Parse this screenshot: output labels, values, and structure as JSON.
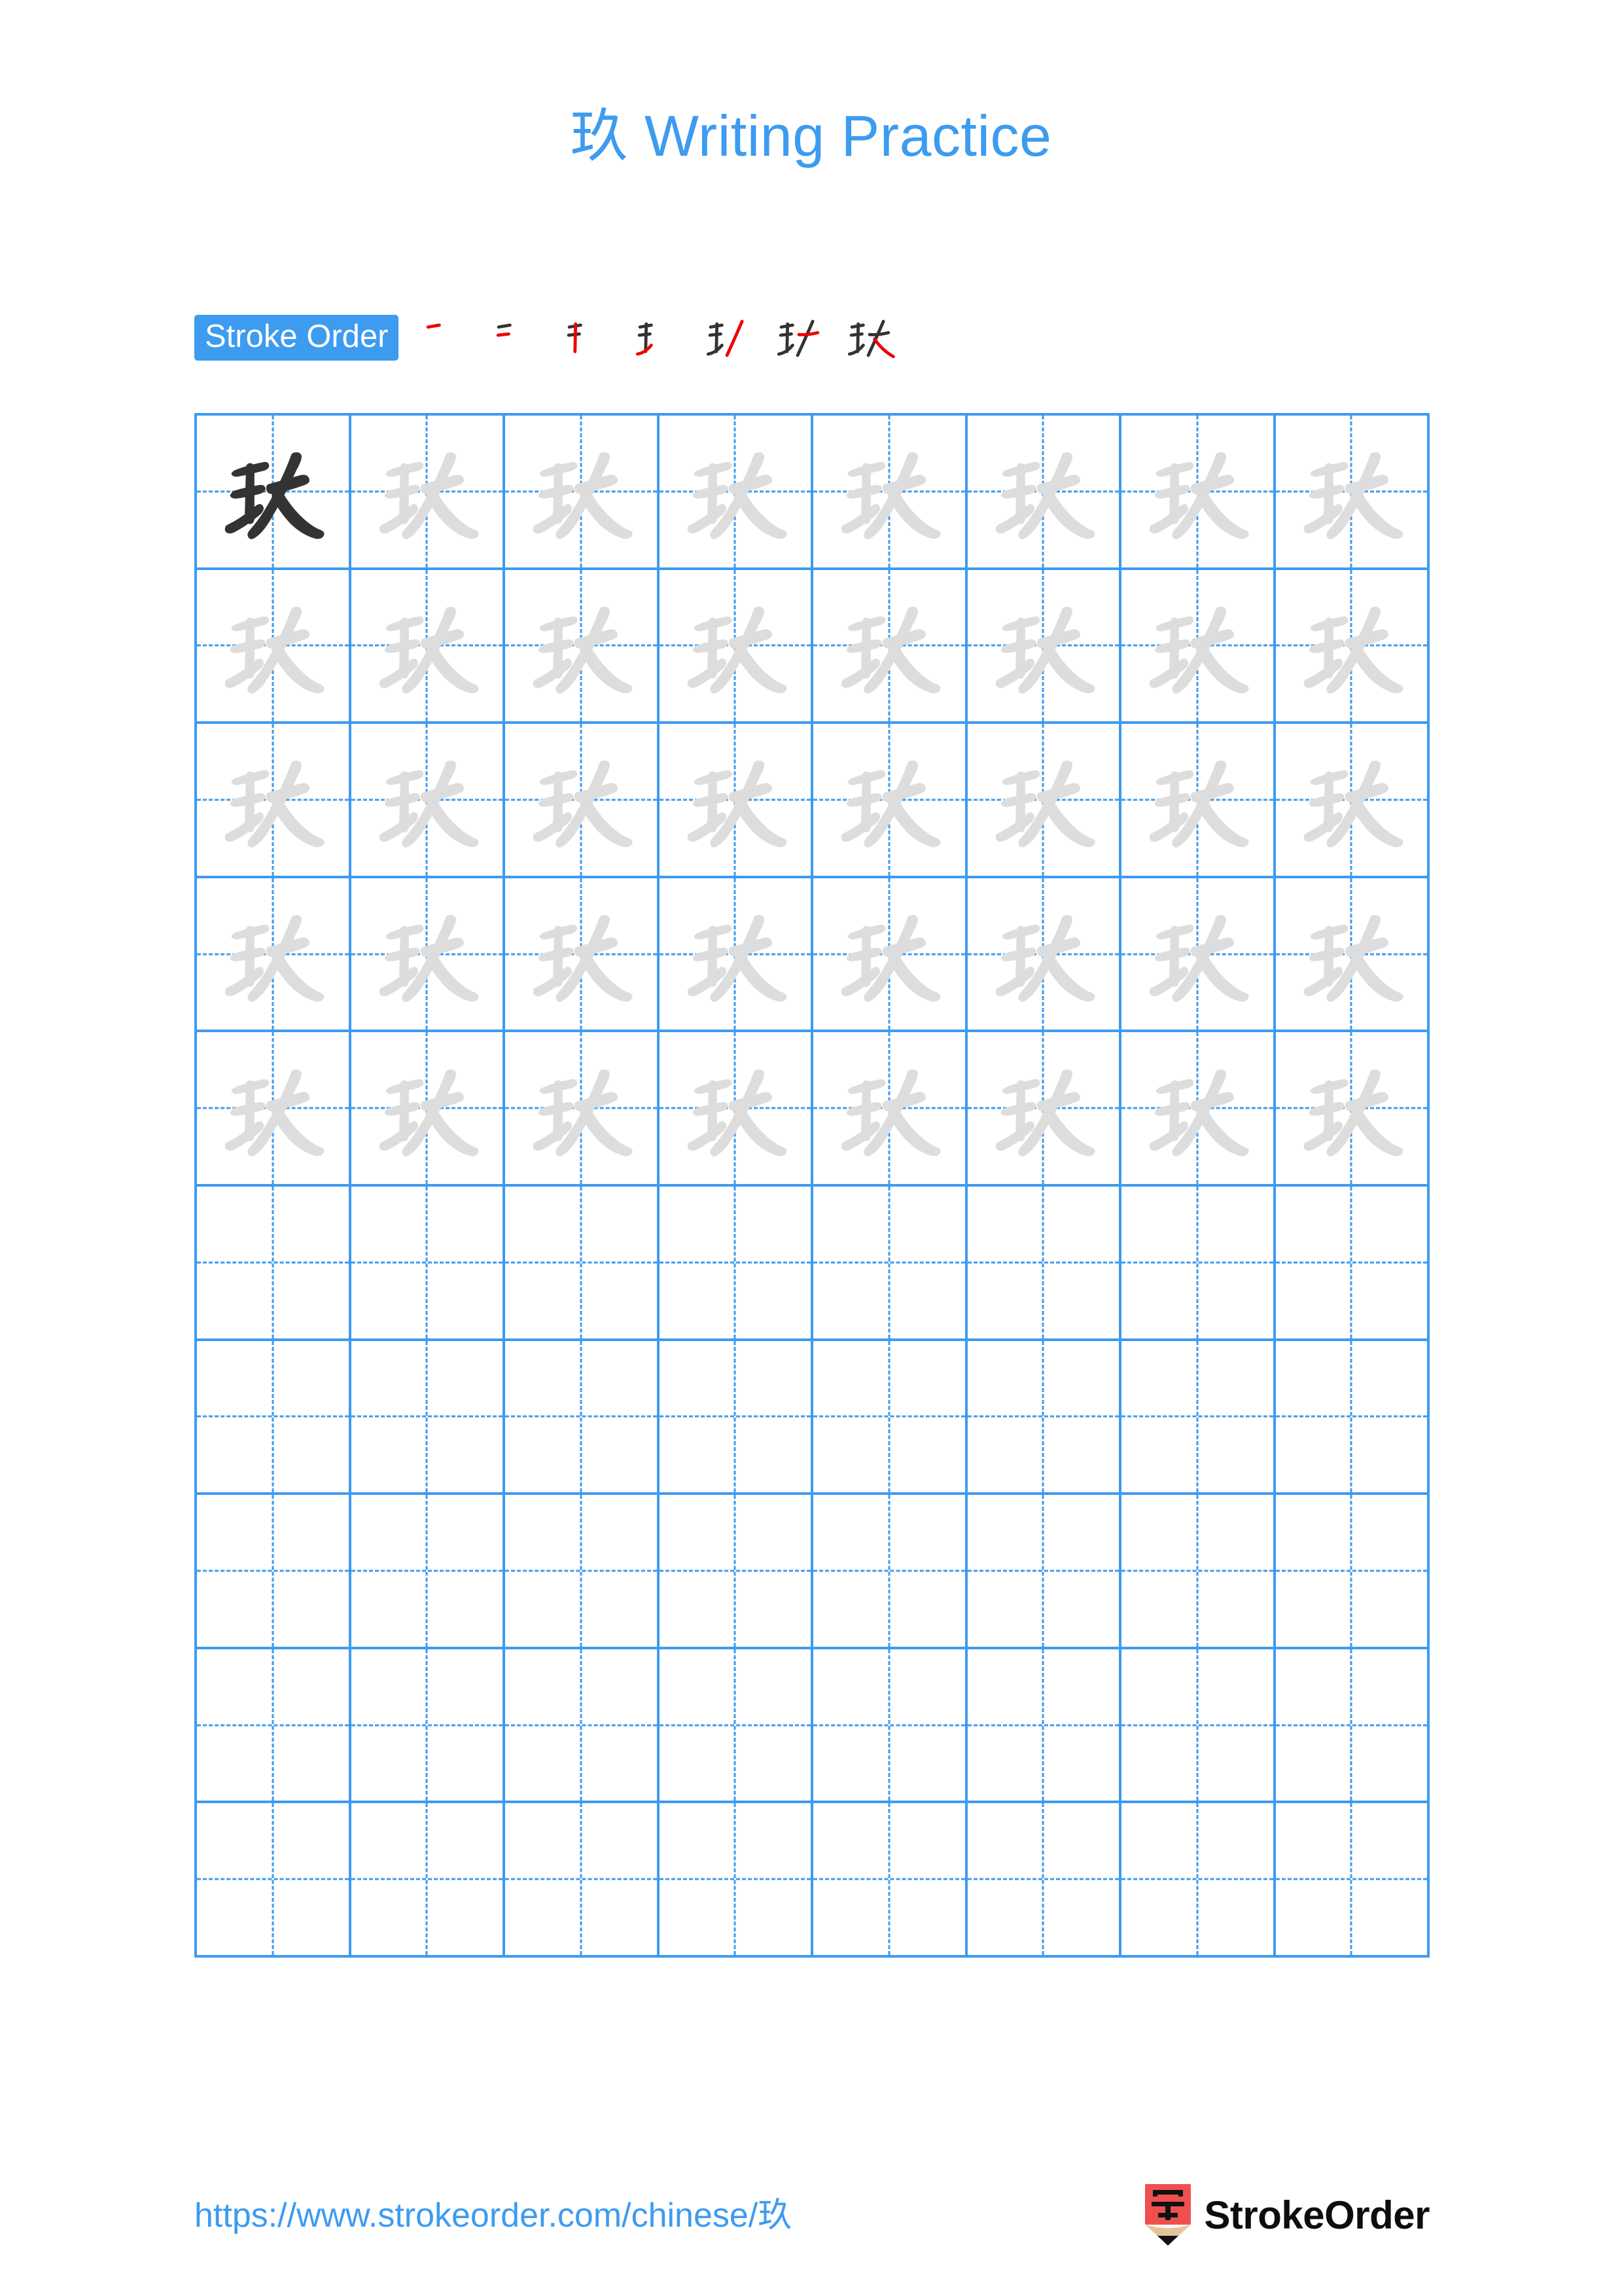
{
  "page": {
    "title": "玖 Writing Practice",
    "character": "玖",
    "background_color": "#ffffff",
    "accent_color": "#3D9BF0"
  },
  "stroke_order": {
    "badge_label": "Stroke Order",
    "badge_bg": "#3D9BF0",
    "badge_text_color": "#ffffff",
    "new_stroke_color": "#ee0000",
    "drawn_stroke_color": "#333333",
    "total_strokes": 7,
    "steps": [
      {
        "index": 1,
        "strokes_shown": 1,
        "new_stroke": 1
      },
      {
        "index": 2,
        "strokes_shown": 2,
        "new_stroke": 2
      },
      {
        "index": 3,
        "strokes_shown": 3,
        "new_stroke": 3
      },
      {
        "index": 4,
        "strokes_shown": 4,
        "new_stroke": 4
      },
      {
        "index": 5,
        "strokes_shown": 5,
        "new_stroke": 5
      },
      {
        "index": 6,
        "strokes_shown": 6,
        "new_stroke": 6
      },
      {
        "index": 7,
        "strokes_shown": 7,
        "new_stroke": 7
      }
    ]
  },
  "grid": {
    "columns": 8,
    "rows": 10,
    "line_color": "#3D9BF0",
    "guide_line_style": "dashed",
    "model_char_color": "#333333",
    "trace_char_color": "#dddddd",
    "model_cells": 1,
    "trace_cells": 39,
    "blank_cells": 40,
    "row_types": [
      "trace",
      "trace",
      "trace",
      "trace",
      "trace",
      "blank",
      "blank",
      "blank",
      "blank",
      "blank"
    ]
  },
  "footer": {
    "url": "https://www.strokeorder.com/chinese/玖",
    "url_color": "#3D9BF0",
    "brand_name": "StrokeOrder",
    "brand_color": "#0d0d0d",
    "logo": {
      "icon_name": "pencil-logo",
      "body_color": "#F04F4F",
      "wood_color": "#E5C49A",
      "tip_color": "#111111",
      "glyph": "字"
    }
  }
}
